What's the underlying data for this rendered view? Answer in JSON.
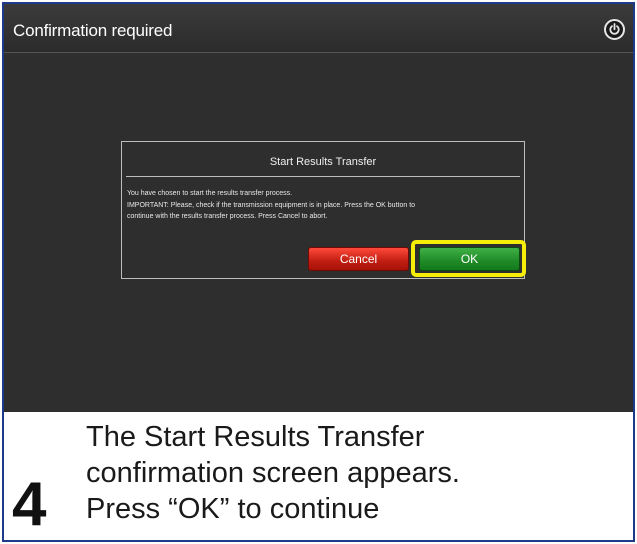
{
  "window": {
    "title": "Confirmation required",
    "power_icon": "power-icon"
  },
  "dialog": {
    "title": "Start Results Transfer",
    "message_lines": [
      "You have chosen to start the results transfer process.",
      "IMPORTANT: Please, check if the transmission equipment is in place. Press the OK button to",
      "continue with the results transfer process. Press Cancel to abort."
    ],
    "cancel_label": "Cancel",
    "ok_label": "OK"
  },
  "caption": {
    "step_number": "4",
    "lines": [
      "The Start Results Transfer",
      "confirmation screen appears.",
      "Press “OK” to continue"
    ]
  },
  "colors": {
    "frame_border": "#1f3a8a",
    "screen_bg": "#2e2e2e",
    "cancel": "#c01d12",
    "ok": "#1f8a27",
    "highlight": "#f6ee08"
  }
}
